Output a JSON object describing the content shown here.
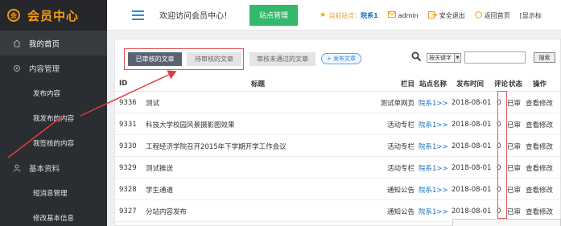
{
  "brand": {
    "title": "会员中心"
  },
  "sidebar": {
    "items": [
      {
        "label": "我的首页",
        "type": "top",
        "active": true,
        "icon": "home-icon"
      },
      {
        "label": "内容管理",
        "type": "top",
        "icon": "gear-icon"
      },
      {
        "label": "发布内容",
        "type": "sub"
      },
      {
        "label": "我发布的内容",
        "type": "sub"
      },
      {
        "label": "我签核的内容",
        "type": "sub"
      },
      {
        "label": "基本资料",
        "type": "top",
        "icon": "user-icon"
      },
      {
        "label": "短消息管理",
        "type": "sub"
      },
      {
        "label": "修改基本信息",
        "type": "sub"
      }
    ]
  },
  "topbar": {
    "welcome": "欢迎访问会员中心！",
    "site_button": "站点管理",
    "current_site_label": "当前站点：",
    "current_site_value": "院系1",
    "username": "admin",
    "logout": "安全退出",
    "home": "返回首页",
    "extra": "[显示标"
  },
  "tabs": {
    "approved": "已审核的文章",
    "pending": "待审核的文章",
    "rejected": "审核未通过的文章",
    "publish": "+ 发布文章"
  },
  "search": {
    "select_value": "按关键字",
    "button": "搜索"
  },
  "table": {
    "headers": {
      "id": "ID",
      "title": "标题",
      "column": "栏目",
      "site": "站点名称",
      "date": "发布时间",
      "count": "评论",
      "status": "状态",
      "ops": "操作"
    },
    "rows": [
      {
        "id": "9336",
        "title": "测试",
        "column": "测试单网页",
        "site": "院系1>>",
        "date": "2018-08-01",
        "count": "0",
        "status": "已审",
        "view": "查看",
        "edit": "修改"
      },
      {
        "id": "9331",
        "title": "科技大学校园风景摄影图效果",
        "column": "活动专栏",
        "site": "院系1>>",
        "date": "2018-08-01",
        "count": "0",
        "status": "已审",
        "view": "查看",
        "edit": "修改"
      },
      {
        "id": "9330",
        "title": "工程经济学院召开2015年下学期开学工作会议",
        "column": "活动专栏",
        "site": "院系1>>",
        "date": "2018-08-01",
        "count": "0",
        "status": "已审",
        "view": "查看",
        "edit": "修改"
      },
      {
        "id": "9329",
        "title": "测试推送",
        "column": "活动专栏",
        "site": "院系1>>",
        "date": "2018-08-01",
        "count": "0",
        "status": "已审",
        "view": "查看",
        "edit": "修改"
      },
      {
        "id": "9328",
        "title": "学生通道",
        "column": "通知公告",
        "site": "院系1>>",
        "date": "2018-08-01",
        "count": "0",
        "status": "已审",
        "view": "查看",
        "edit": "修改"
      },
      {
        "id": "9327",
        "title": "分站内容发布",
        "column": "通知公告",
        "site": "院系1>>",
        "date": "2018-08-01",
        "count": "0",
        "status": "已审",
        "view": "查看",
        "edit": "修改"
      }
    ]
  },
  "colors": {
    "accent": "#f39c12",
    "sidebar": "#2a2d32",
    "green": "#34b86b",
    "highlight": "#e05a5a"
  }
}
